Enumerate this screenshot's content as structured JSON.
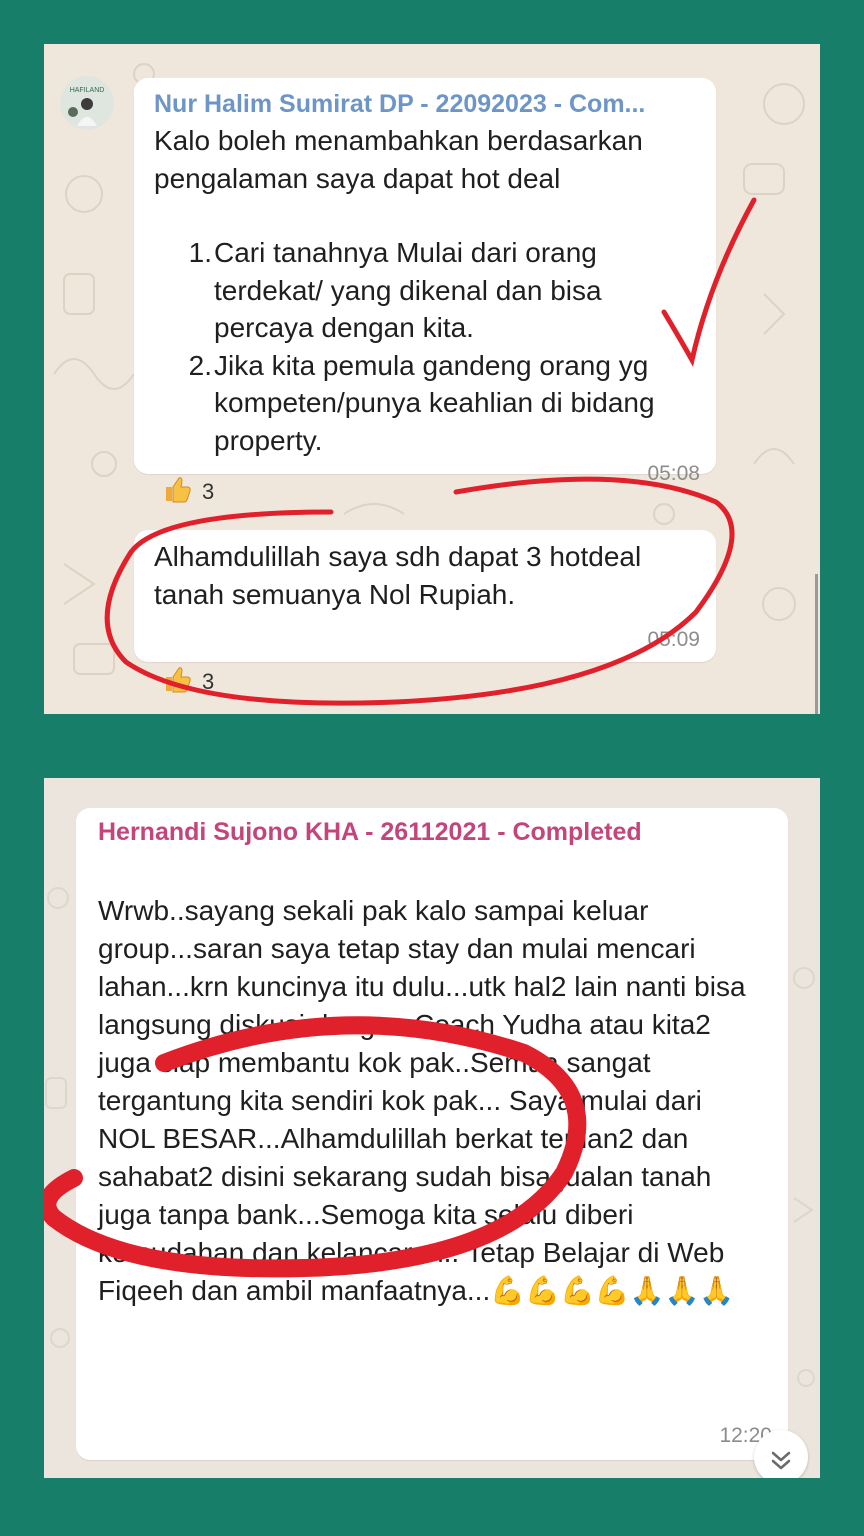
{
  "screenshot_1": {
    "message_1": {
      "sender": "Nur Halim Sumirat DP - 22092023 - Com...",
      "intro": "Kalo boleh menambahkan berdasarkan pengalaman saya dapat hot deal",
      "list_items": [
        {
          "num": "1.",
          "text": "Cari tanahnya Mulai dari orang terdekat/ yang dikenal dan bisa percaya dengan kita."
        },
        {
          "num": "2.",
          "text": "Jika kita pemula gandeng orang yg kompeten/punya keahlian di bidang property."
        }
      ],
      "time": "05:08",
      "reaction_count": "3"
    },
    "message_2": {
      "text": "Alhamdulillah saya sdh dapat 3 hotdeal tanah semuanya Nol Rupiah.",
      "time": "05:09",
      "reaction_count": "3"
    },
    "avatar_label": "HAFILAND",
    "reaction_icon": "thumbs-up-icon"
  },
  "screenshot_2": {
    "message": {
      "sender": "Hernandi Sujono KHA - 26112021 - Completed",
      "text": "Wrwb..sayang sekali pak kalo sampai keluar group...saran saya tetap stay dan mulai mencari lahan...krn kuncinya itu dulu...utk hal2 lain nanti bisa langsung diskusi dengan Coach Yudha atau kita2 juga siap membantu kok pak..Semua sangat tergantung kita sendiri kok pak... Saya mulai dari NOL BESAR...Alhamdulillah berkat teman2 dan sahabat2 disini sekarang sudah bisa jualan tanah juga tanpa bank...Semoga kita selalu diberi kemudahan dan kelancaran.. Tetap Belajar di Web Fiqeeh dan ambil manfaatnya...💪💪💪💪🙏🙏🙏",
      "time": "12:20"
    },
    "scroll_icon": "chevron-double-down-icon"
  },
  "colors": {
    "background": "#177e6a",
    "sender_1": "#6e95c7",
    "sender_2": "#c3457c",
    "annotation": "#e0202a"
  }
}
